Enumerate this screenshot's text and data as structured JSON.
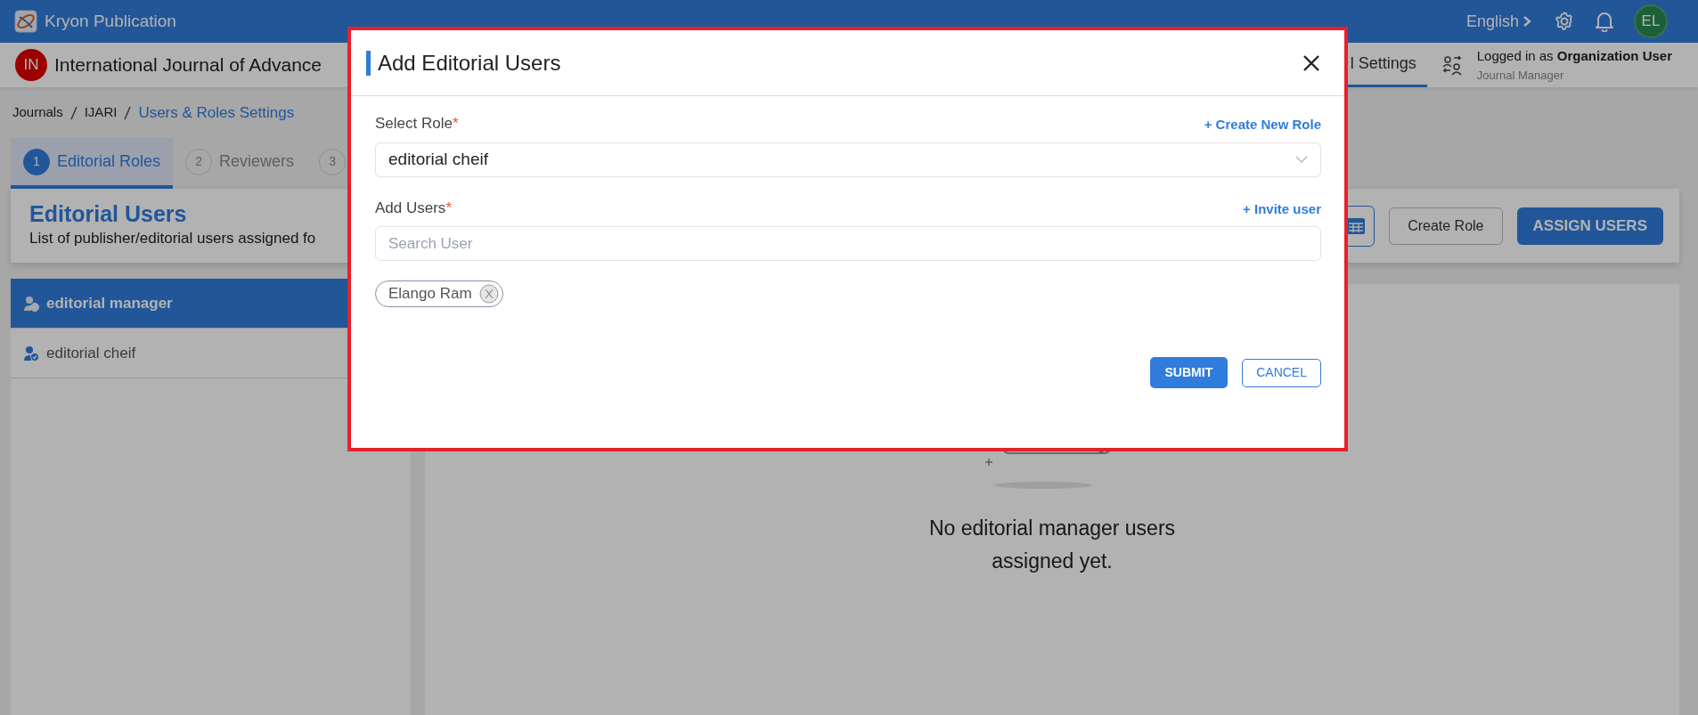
{
  "app": {
    "title": "Kryon Publication",
    "language": "English",
    "avatar": "EL"
  },
  "journal": {
    "badge": "IN",
    "title": "International Journal of Advance",
    "tabs": [
      {
        "label": "l Settings",
        "selected": true
      }
    ],
    "login": {
      "text": "Logged in as **Organization User**",
      "role": "Journal Manager"
    }
  },
  "breadcrumb": [
    {
      "label": "Journals",
      "current": false
    },
    {
      "label": "IJARI",
      "current": false
    },
    {
      "label": "Users & Roles Settings",
      "current": true
    }
  ],
  "steps": [
    {
      "number": "1",
      "label": "Editorial Roles",
      "selected": true
    },
    {
      "number": "2",
      "label": "Reviewers",
      "selected": false
    },
    {
      "number": "3",
      "selected": false
    }
  ],
  "section": {
    "title": "Editorial Users",
    "subtitle": "List of publisher/editorial users assigned fo",
    "buttons": [
      {
        "kind": "icon"
      },
      {
        "kind": "outline",
        "label": "Create Role"
      },
      {
        "kind": "primary",
        "label": "ASSIGN USERS"
      }
    ]
  },
  "roles": [
    {
      "label": "editorial manager",
      "selected": true
    },
    {
      "label": "editorial cheif",
      "selected": false
    }
  ],
  "empty_state": {
    "message": "No editorial manager users assigned yet."
  },
  "modal": {
    "title": "Add Editorial Users",
    "fields": [
      {
        "kind": "select",
        "label": "Select Role",
        "required_mark": "*",
        "link": "+ Create New Role",
        "value": "editorial cheif"
      },
      {
        "kind": "search",
        "label": "Add Users",
        "required_mark": "*",
        "link": "+ Invite user",
        "placeholder": "Search User"
      }
    ],
    "chips": [
      {
        "label": "Elango Ram"
      }
    ],
    "buttons": [
      {
        "kind": "primary",
        "label": "SUBMIT"
      },
      {
        "kind": "outline",
        "label": "CANCEL"
      }
    ]
  }
}
